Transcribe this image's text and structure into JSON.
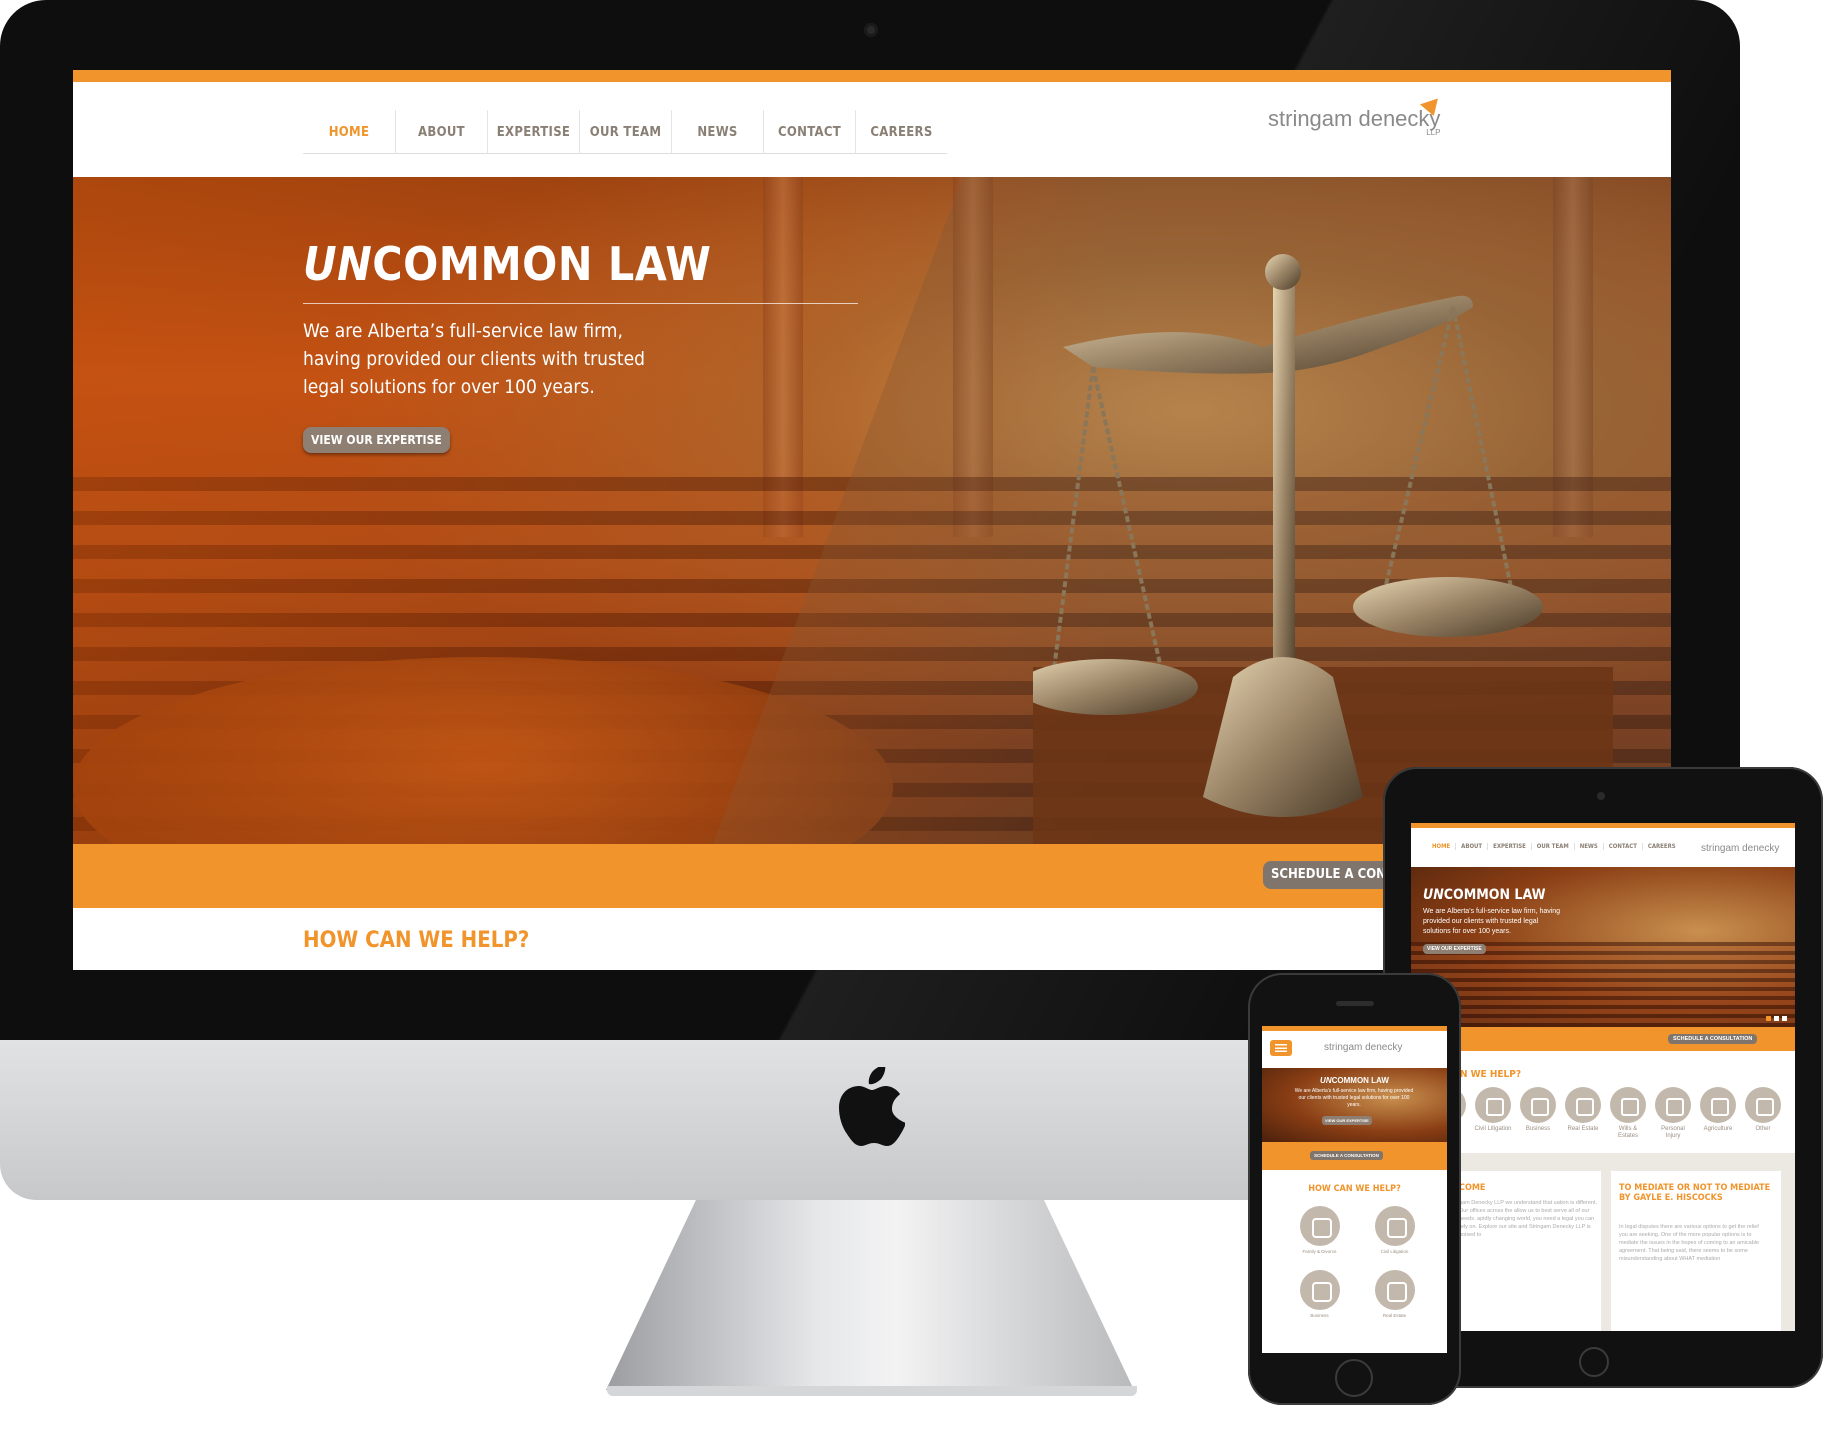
{
  "desktop": {
    "nav": [
      "HOME",
      "ABOUT",
      "EXPERTISE",
      "OUR TEAM",
      "NEWS",
      "CONTACT",
      "CAREERS"
    ],
    "logo": "stringam denecky",
    "logo_sub": "LLP",
    "hero": {
      "title_em": "UN",
      "title_rest": "COMMON LAW",
      "text": "We are Alberta’s full-service law firm, having provided our clients with trusted legal solutions for over 100 years.",
      "button": "VIEW OUR EXPERTISE"
    },
    "cta_button": "SCHEDULE A CONSU",
    "help_title": "HOW CAN WE HELP?"
  },
  "tablet": {
    "nav": [
      "HOME",
      "ABOUT",
      "EXPERTISE",
      "OUR TEAM",
      "NEWS",
      "CONTACT",
      "CAREERS"
    ],
    "logo": "stringam denecky",
    "hero_title_em": "UN",
    "hero_title_rest": "COMMON LAW",
    "hero_text": "We are Alberta’s full-service law firm, having provided our clients with trusted legal solutions for over 100 years.",
    "hero_button": "VIEW OUR EXPERTISE",
    "cta_button": "SCHEDULE A CONSULTATION",
    "help_title": "AN WE HELP?",
    "icons": [
      {
        "label": "",
        "icon": "ring-icon"
      },
      {
        "label": "Civil Litigation",
        "icon": "courthouse-icon"
      },
      {
        "label": "Business",
        "icon": "handshake-icon"
      },
      {
        "label": "Real Estate",
        "icon": "house-icon"
      },
      {
        "label": "Wills & Estates",
        "icon": "piggy-bank-icon"
      },
      {
        "label": "Personal Injury",
        "icon": "plus-icon"
      },
      {
        "label": "Agriculture",
        "icon": "wheat-icon"
      },
      {
        "label": "Other",
        "icon": "scales-icon"
      }
    ],
    "card1_title": "COME",
    "card1_text": "gam Denecky LLP we understand that uation is different. Our offices across the allow us to best serve all of our needs. apidly changing world, you need a legal you can rely on. Explore our site and Stringam Denecky LLP is poised to",
    "card2_title": "TO MEDIATE OR NOT TO MEDIATE BY GAYLE E. HISCOCKS",
    "card2_text": "In legal disputes there are various options to get the relief you are seeking. One of the more popular options is to mediate the issues in the hopes of coming to an amicable agreement. That being said, there seems to be some misunderstanding about WHAT mediation"
  },
  "phone": {
    "logo": "stringam denecky",
    "hero_title_em": "UN",
    "hero_title_rest": "COMMON LAW",
    "hero_text": "We are Alberta’s full-service law firm, having provided our clients with trusted legal solutions for over 100 years.",
    "hero_button": "VIEW OUR EXPERTISE",
    "cta_button": "SCHEDULE A CONSULTATION",
    "help_title": "HOW CAN WE HELP?",
    "icons": [
      {
        "label": "Family & Divorce",
        "icon": "rings-icon"
      },
      {
        "label": "Civil Litigation",
        "icon": "courthouse-icon"
      },
      {
        "label": "Business",
        "icon": "handshake-icon"
      },
      {
        "label": "Real Estate",
        "icon": "house-icon"
      }
    ]
  },
  "colors": {
    "accent": "#f0942b",
    "button": "#8e7f72",
    "text_muted": "#8a7f74"
  }
}
